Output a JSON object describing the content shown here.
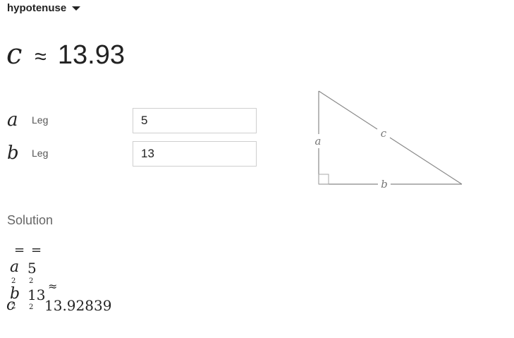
{
  "selector": {
    "label": "hypotenuse"
  },
  "result": {
    "variable": "c",
    "approx_symbol": "≈",
    "value": "13.93"
  },
  "inputs": [
    {
      "symbol": "a",
      "label": "Leg",
      "value": "5"
    },
    {
      "symbol": "b",
      "label": "Leg",
      "value": "13"
    }
  ],
  "diagram": {
    "side_a": "a",
    "side_b": "b",
    "side_c": "c"
  },
  "solution": {
    "title": "Solution",
    "equals_1": "=",
    "equals_2": "=",
    "a_sym": "a",
    "a_exp": "2",
    "a_val": "5",
    "a_val_exp": "2",
    "b_sym": "b",
    "b_exp": "2",
    "b_val": "13",
    "b_val_exp": "2",
    "approx": "≈",
    "c_sym": "c",
    "c_exp": "2",
    "c_val": "13.92839"
  }
}
